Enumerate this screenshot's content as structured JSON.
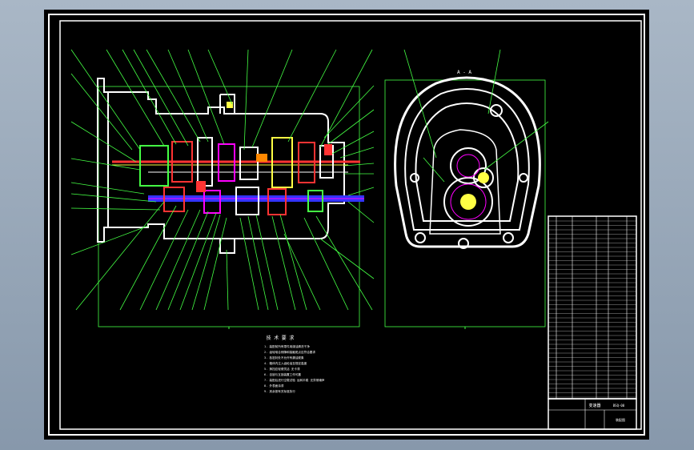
{
  "drawing": {
    "section_label": "A - A",
    "notes_title": "技 术 要 求",
    "notes": [
      "1. 装配前所有零件用煤油清洗干净",
      "2. 齿轮啮合侧隙和接触斑点应符合要求",
      "3. 各密封处不允许有漏油现象",
      "4. 箱体内注入齿轮油至规定高度",
      "5. 换挡应轻便灵活 无卡滞",
      "6. 自锁与互锁装置工作可靠",
      "7. 装配后进行空载试验 运转平稳 无异常噪声",
      "8. 外表面涂漆",
      "9. 其余按有关标准执行"
    ],
    "title_block": {
      "name": "变速器",
      "drawing_no": "BSQ-00",
      "material": "装配图"
    }
  }
}
